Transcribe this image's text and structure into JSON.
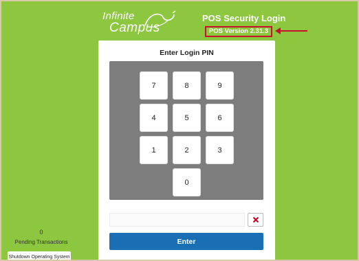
{
  "header": {
    "logo_line1": "Infinite",
    "logo_line2": "Campus",
    "title": "POS Security Login",
    "version": "POS Version 2.31.3"
  },
  "colors": {
    "background": "#8dc63f",
    "primary_button": "#1a6fb4",
    "keypad_bg": "#7d7d7d",
    "highlight": "#c8102e"
  },
  "login": {
    "title": "Enter Login PIN",
    "keys": [
      {
        "label": "7"
      },
      {
        "label": "8"
      },
      {
        "label": "9"
      },
      {
        "label": "4"
      },
      {
        "label": "5"
      },
      {
        "label": "6"
      },
      {
        "label": "1"
      },
      {
        "label": "2"
      },
      {
        "label": "3"
      },
      {
        "label": "0"
      }
    ],
    "pin_value": "",
    "clear_icon": "close-icon",
    "enter_label": "Enter"
  },
  "pending": {
    "count": "0",
    "label": "Pending Transactions"
  },
  "shutdown_label": "Shutdown Operating System"
}
